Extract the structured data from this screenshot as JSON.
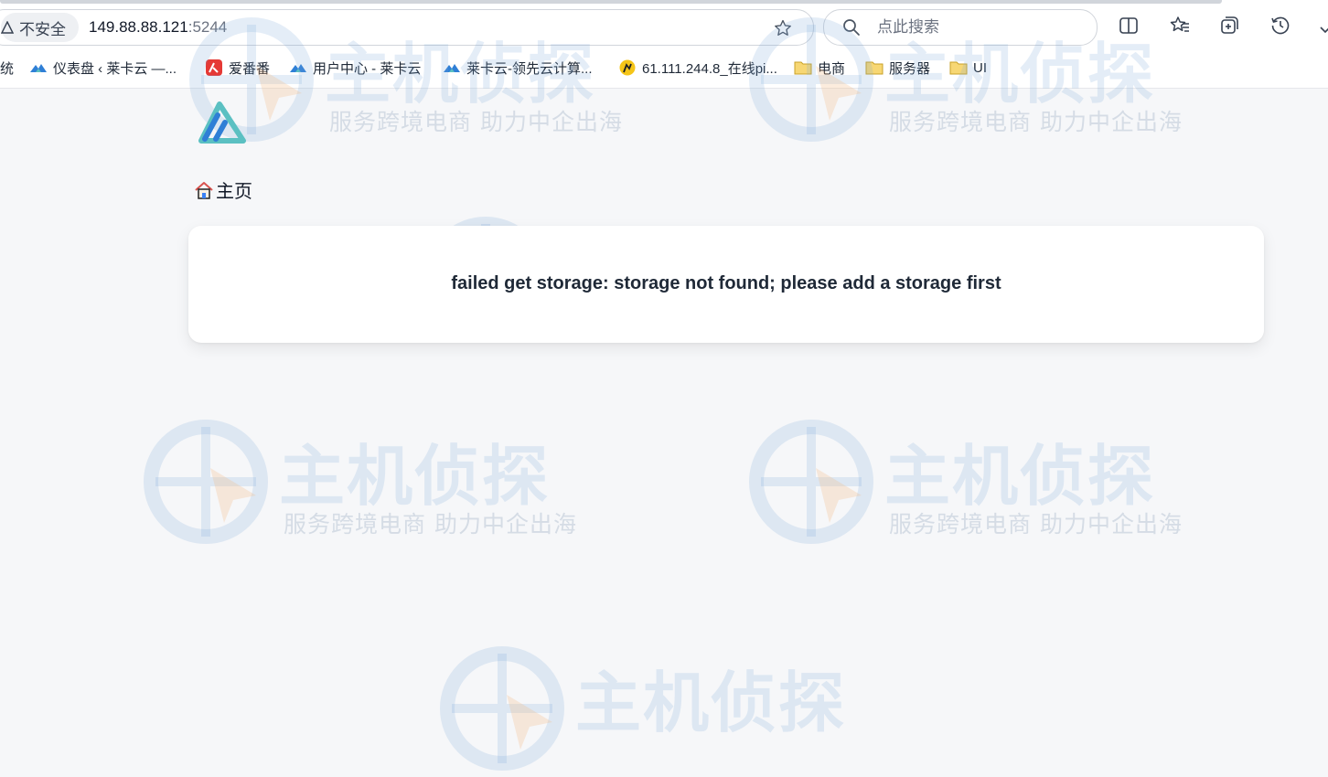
{
  "browser": {
    "security_label": "不安全",
    "url_host": "149.88.88.121",
    "url_port": ":5244",
    "search_placeholder": "点此搜索"
  },
  "bookmarks": [
    {
      "label": "统",
      "icon": "cut-off-icon"
    },
    {
      "label": "仪表盘 ‹ 莱卡云 —...",
      "icon": "laika-cloud-icon"
    },
    {
      "label": "爱番番",
      "icon": "aifanfan-icon"
    },
    {
      "label": "用户中心 - 莱卡云",
      "icon": "laika-cloud-icon"
    },
    {
      "label": "莱卡云-领先云计算...",
      "icon": "laika-cloud-icon"
    },
    {
      "label": "61.111.244.8_在线pi...",
      "icon": "ping-icon"
    },
    {
      "label": "电商",
      "icon": "folder-icon"
    },
    {
      "label": "服务器",
      "icon": "folder-icon"
    },
    {
      "label": "UI",
      "icon": "folder-icon"
    }
  ],
  "watermark": {
    "title": "主机侦探",
    "subtitle": "服务跨境电商 助力中企出海"
  },
  "page": {
    "breadcrumb_home": "主页",
    "error_message": "failed get storage: storage not found; please add a storage first"
  },
  "colors": {
    "background": "#f6f7f9",
    "logo_teal": "#5bc0c2",
    "logo_blue": "#2f7fd6",
    "watermark_blue": "#78a5d7",
    "watermark_orange": "#f4b27a"
  }
}
